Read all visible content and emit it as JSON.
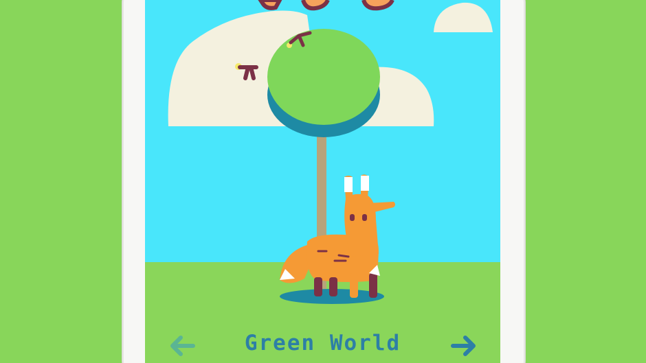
{
  "world": {
    "title": "Green World"
  },
  "nav": {
    "prev_icon": "arrow-left-icon",
    "next_icon": "arrow-right-icon"
  },
  "colors": {
    "background": "#88d65a",
    "sky": "#49e6fb",
    "ground": "#8ad65a",
    "cloud": "#f4f1df",
    "tree_top": "#7fd75a",
    "tree_shadow": "#1e8aa4",
    "trunk": "#b7a37a",
    "fox": "#f59a35",
    "fox_accent": "#7b3146",
    "title_text": "#2d7fa6",
    "prev_arrow": "#5bb593",
    "next_arrow": "#2d7fa6"
  }
}
